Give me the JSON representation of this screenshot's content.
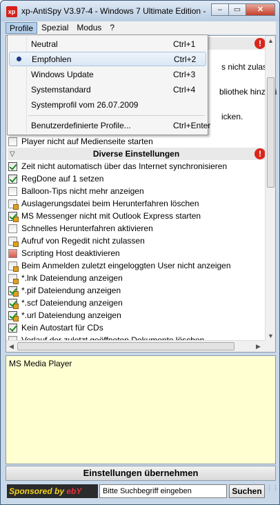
{
  "window": {
    "title": "xp-AntiSpy V3.97-4 - Windows 7 Ultimate Edition -",
    "app_icon": "xp",
    "minimize": "–",
    "maximize": "▭",
    "close": "✕"
  },
  "menubar": {
    "items": [
      "Profile",
      "Spezial",
      "Modus",
      "?"
    ]
  },
  "profile_menu": {
    "items": [
      {
        "label": "Neutral",
        "shortcut": "Ctrl+1"
      },
      {
        "label": "Empfohlen",
        "shortcut": "Ctrl+2",
        "selected": true
      },
      {
        "label": "Windows Update",
        "shortcut": "Ctrl+3"
      },
      {
        "label": "Systemstandard",
        "shortcut": "Ctrl+4"
      },
      {
        "label": "Systemprofil vom 26.07.2009",
        "shortcut": ""
      },
      {
        "label": "Benutzerdefinierte Profile...",
        "shortcut": "Ctrl+Enter"
      }
    ]
  },
  "partial_texts": {
    "p1": "s nicht zulasse",
    "p2": "bliothek hinzufü",
    "p3": "icken."
  },
  "settings": {
    "player_item": {
      "label": "Player nicht auf Medienseite starten",
      "checked": false
    },
    "section_title": "Diverse Einstellungen",
    "section_arrow": "▽",
    "warn": "!",
    "items": [
      {
        "label": "Zeit nicht automatisch über das Internet synchronisieren",
        "checked": true
      },
      {
        "label": "RegDone auf 1 setzen",
        "checked": true
      },
      {
        "label": "Balloon-Tips nicht mehr anzeigen",
        "checked": false
      },
      {
        "label": "Auslagerungsdatei beim Herunterfahren löschen",
        "checked": false
      },
      {
        "label": "MS Messenger nicht mit Outlook Express starten",
        "checked": true
      },
      {
        "label": "Schnelles Herunterfahren aktivieren",
        "checked": false
      },
      {
        "label": "Aufruf von Regedit nicht zulassen",
        "checked": false
      },
      {
        "label": "Scripting Host deaktivieren",
        "checked": false
      },
      {
        "label": "Beim Anmelden zuletzt eingeloggten User nicht anzeigen",
        "checked": false
      },
      {
        "label": "*.lnk Dateiendung anzeigen",
        "checked": false
      },
      {
        "label": "*.pif Dateiendung anzeigen",
        "checked": true
      },
      {
        "label": "*.scf Dateiendung anzeigen",
        "checked": true
      },
      {
        "label": "*.url Dateiendung anzeigen",
        "checked": true
      },
      {
        "label": "Kein Autostart für CDs",
        "checked": true
      },
      {
        "label": "Verlauf der zuletzt geöffneten Dokumente löschen",
        "checked": false
      }
    ]
  },
  "scroll": {
    "up": "▲",
    "down": "▼",
    "left": "◀",
    "right": "▶"
  },
  "description": "MS Media Player",
  "apply_button": "Einstellungen übernehmen",
  "adbar": {
    "sponsor_text": "Sponsored by",
    "ebay_text": "ebY",
    "search_placeholder": "Bitte Suchbegriff eingeben",
    "search_button": "Suchen",
    "grip": "⋮⋮"
  },
  "colors": {
    "accent": "#1e3a87",
    "warning": "#d9261c",
    "description_bg": "#ffffd2"
  }
}
